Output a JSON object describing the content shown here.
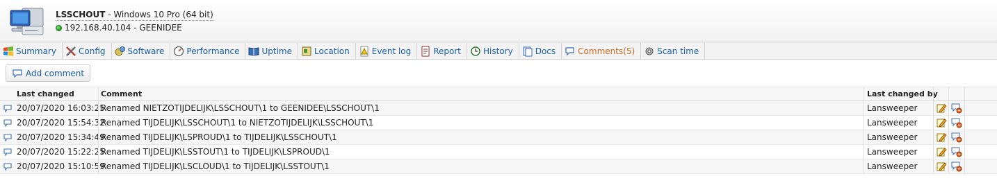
{
  "header": {
    "hostname": "LSSCHOUT",
    "os": " - Windows 10 Pro (64 bit)",
    "ip_domain": "192.168.40.104 - GEENIDEE",
    "status_color": "#1a9a1a"
  },
  "tabs": [
    {
      "label": "Summary",
      "icon": "windows-logo-icon"
    },
    {
      "label": "Config",
      "icon": "tools-icon"
    },
    {
      "label": "Software",
      "icon": "software-icon"
    },
    {
      "label": "Performance",
      "icon": "gauge-icon"
    },
    {
      "label": "Uptime",
      "icon": "book-icon"
    },
    {
      "label": "Location",
      "icon": "map-icon"
    },
    {
      "label": "Event log",
      "icon": "warning-icon"
    },
    {
      "label": "Report",
      "icon": "report-icon"
    },
    {
      "label": "History",
      "icon": "history-icon"
    },
    {
      "label": "Docs",
      "icon": "docs-icon"
    },
    {
      "label": "Comments(5)",
      "icon": "comments-icon"
    },
    {
      "label": "Scan time",
      "icon": "scan-gear-icon"
    }
  ],
  "toolbar": {
    "add_comment_label": "Add comment"
  },
  "table": {
    "headers": {
      "last_changed": "Last changed",
      "comment": "Comment",
      "changed_by": "Last changed by"
    },
    "rows": [
      {
        "date": "20/07/2020 16:03:25",
        "comment": "Renamed NIETZOTIJDELIJK\\LSSCHOUT\\1 to GEENIDEE\\LSSCHOUT\\1",
        "by": "Lansweeper"
      },
      {
        "date": "20/07/2020 15:54:32",
        "comment": "Renamed TIJDELIJK\\LSSCHOUT\\1 to NIETZOTIJDELIJK\\LSSCHOUT\\1",
        "by": "Lansweeper"
      },
      {
        "date": "20/07/2020 15:34:49",
        "comment": "Renamed TIJDELIJK\\LSPROUD\\1 to TIJDELIJK\\LSSCHOUT\\1",
        "by": "Lansweeper"
      },
      {
        "date": "20/07/2020 15:22:25",
        "comment": "Renamed TIJDELIJK\\LSSTOUT\\1 to TIJDELIJK\\LSPROUD\\1",
        "by": "Lansweeper"
      },
      {
        "date": "20/07/2020 15:10:59",
        "comment": "Renamed TIJDELIJK\\LSCLOUD\\1 to TIJDELIJK\\LSSTOUT\\1",
        "by": "Lansweeper"
      }
    ]
  },
  "colors": {
    "link": "#1a5fa8",
    "active_tab": "#d06a1e"
  }
}
